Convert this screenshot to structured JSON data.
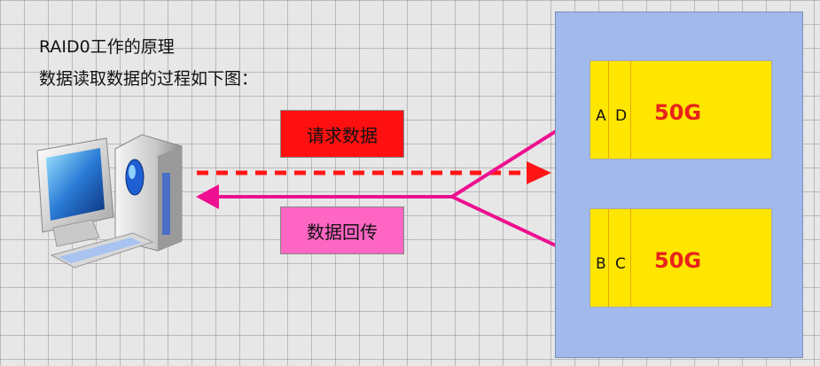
{
  "diagram": {
    "title": "RAID0工作的原理",
    "subtitle": "数据读取数据的过程如下图：",
    "request_label": "请求数据",
    "response_label": "数据回传",
    "disks": [
      {
        "blocks": [
          "A",
          "D"
        ],
        "capacity": "50G"
      },
      {
        "blocks": [
          "B",
          "C"
        ],
        "capacity": "50G"
      }
    ],
    "colors": {
      "request": "#ff1010",
      "response": "#ff66c4",
      "disk": "#ffe600",
      "raid_group": "#a2b9ec",
      "capacity_text": "#e8231b",
      "return_line": "#ee1090"
    },
    "icons": [
      "computer-icon"
    ]
  }
}
